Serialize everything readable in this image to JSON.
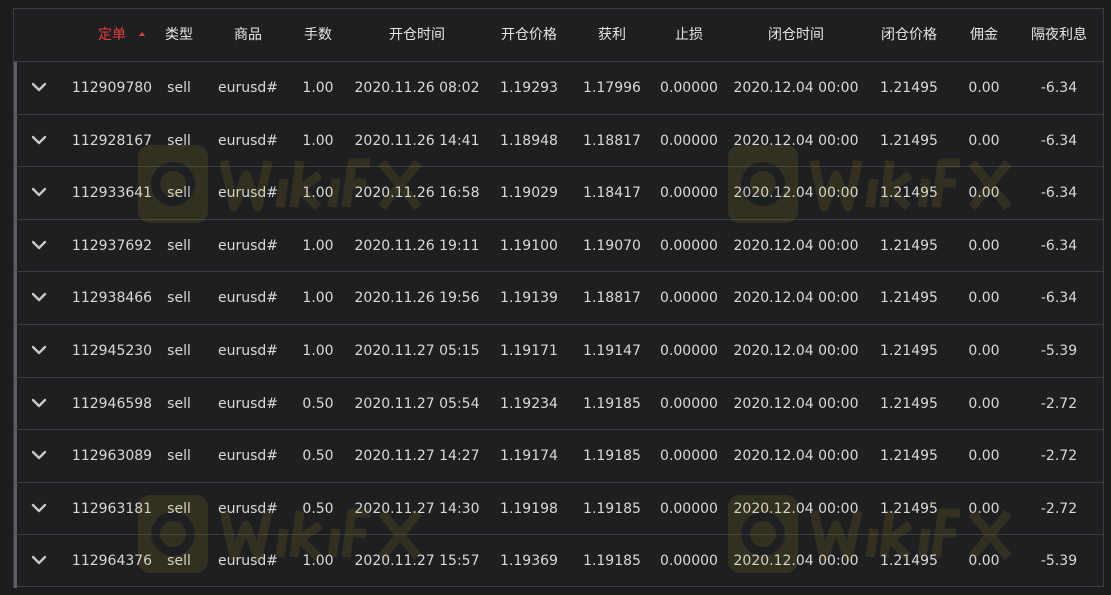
{
  "columns": [
    {
      "key": "order",
      "label": "定单",
      "sorted": true
    },
    {
      "key": "type",
      "label": "类型"
    },
    {
      "key": "symbol",
      "label": "商品"
    },
    {
      "key": "lots",
      "label": "手数"
    },
    {
      "key": "open_time",
      "label": "开仓时间"
    },
    {
      "key": "open_price",
      "label": "开仓价格"
    },
    {
      "key": "take_profit",
      "label": "获利"
    },
    {
      "key": "stop_loss",
      "label": "止损"
    },
    {
      "key": "close_time",
      "label": "闭仓时间"
    },
    {
      "key": "close_price",
      "label": "闭仓价格"
    },
    {
      "key": "commission",
      "label": "佣金"
    },
    {
      "key": "swap",
      "label": "隔夜利息"
    }
  ],
  "rows": [
    {
      "order": "112909780",
      "type": "sell",
      "symbol": "eurusd#",
      "lots": "1.00",
      "open_time": "2020.11.26 08:02",
      "open_price": "1.19293",
      "take_profit": "1.17996",
      "stop_loss": "0.00000",
      "close_time": "2020.12.04 00:00",
      "close_price": "1.21495",
      "commission": "0.00",
      "swap": "-6.34"
    },
    {
      "order": "112928167",
      "type": "sell",
      "symbol": "eurusd#",
      "lots": "1.00",
      "open_time": "2020.11.26 14:41",
      "open_price": "1.18948",
      "take_profit": "1.18817",
      "stop_loss": "0.00000",
      "close_time": "2020.12.04 00:00",
      "close_price": "1.21495",
      "commission": "0.00",
      "swap": "-6.34"
    },
    {
      "order": "112933641",
      "type": "sell",
      "symbol": "eurusd#",
      "lots": "1.00",
      "open_time": "2020.11.26 16:58",
      "open_price": "1.19029",
      "take_profit": "1.18417",
      "stop_loss": "0.00000",
      "close_time": "2020.12.04 00:00",
      "close_price": "1.21495",
      "commission": "0.00",
      "swap": "-6.34"
    },
    {
      "order": "112937692",
      "type": "sell",
      "symbol": "eurusd#",
      "lots": "1.00",
      "open_time": "2020.11.26 19:11",
      "open_price": "1.19100",
      "take_profit": "1.19070",
      "stop_loss": "0.00000",
      "close_time": "2020.12.04 00:00",
      "close_price": "1.21495",
      "commission": "0.00",
      "swap": "-6.34"
    },
    {
      "order": "112938466",
      "type": "sell",
      "symbol": "eurusd#",
      "lots": "1.00",
      "open_time": "2020.11.26 19:56",
      "open_price": "1.19139",
      "take_profit": "1.18817",
      "stop_loss": "0.00000",
      "close_time": "2020.12.04 00:00",
      "close_price": "1.21495",
      "commission": "0.00",
      "swap": "-6.34"
    },
    {
      "order": "112945230",
      "type": "sell",
      "symbol": "eurusd#",
      "lots": "1.00",
      "open_time": "2020.11.27 05:15",
      "open_price": "1.19171",
      "take_profit": "1.19147",
      "stop_loss": "0.00000",
      "close_time": "2020.12.04 00:00",
      "close_price": "1.21495",
      "commission": "0.00",
      "swap": "-5.39"
    },
    {
      "order": "112946598",
      "type": "sell",
      "symbol": "eurusd#",
      "lots": "0.50",
      "open_time": "2020.11.27 05:54",
      "open_price": "1.19234",
      "take_profit": "1.19185",
      "stop_loss": "0.00000",
      "close_time": "2020.12.04 00:00",
      "close_price": "1.21495",
      "commission": "0.00",
      "swap": "-2.72"
    },
    {
      "order": "112963089",
      "type": "sell",
      "symbol": "eurusd#",
      "lots": "0.50",
      "open_time": "2020.11.27 14:27",
      "open_price": "1.19174",
      "take_profit": "1.19185",
      "stop_loss": "0.00000",
      "close_time": "2020.12.04 00:00",
      "close_price": "1.21495",
      "commission": "0.00",
      "swap": "-2.72"
    },
    {
      "order": "112963181",
      "type": "sell",
      "symbol": "eurusd#",
      "lots": "0.50",
      "open_time": "2020.11.27 14:30",
      "open_price": "1.19198",
      "take_profit": "1.19185",
      "stop_loss": "0.00000",
      "close_time": "2020.12.04 00:00",
      "close_price": "1.21495",
      "commission": "0.00",
      "swap": "-2.72"
    },
    {
      "order": "112964376",
      "type": "sell",
      "symbol": "eurusd#",
      "lots": "1.00",
      "open_time": "2020.11.27 15:57",
      "open_price": "1.19369",
      "take_profit": "1.19185",
      "stop_loss": "0.00000",
      "close_time": "2020.12.04 00:00",
      "close_price": "1.21495",
      "commission": "0.00",
      "swap": "-5.39"
    }
  ],
  "watermark": {
    "text": "WikiFX",
    "icon": "wikifx-logo-icon"
  },
  "colors": {
    "background": "#1e1f21",
    "divider": "#3a3c3f",
    "text": "#d9d9d9",
    "sorted_header": "#e53b3b",
    "watermark": "#c9a227"
  },
  "icons": {
    "expand": "chevron-down-icon",
    "sort": "sort-asc-icon"
  }
}
